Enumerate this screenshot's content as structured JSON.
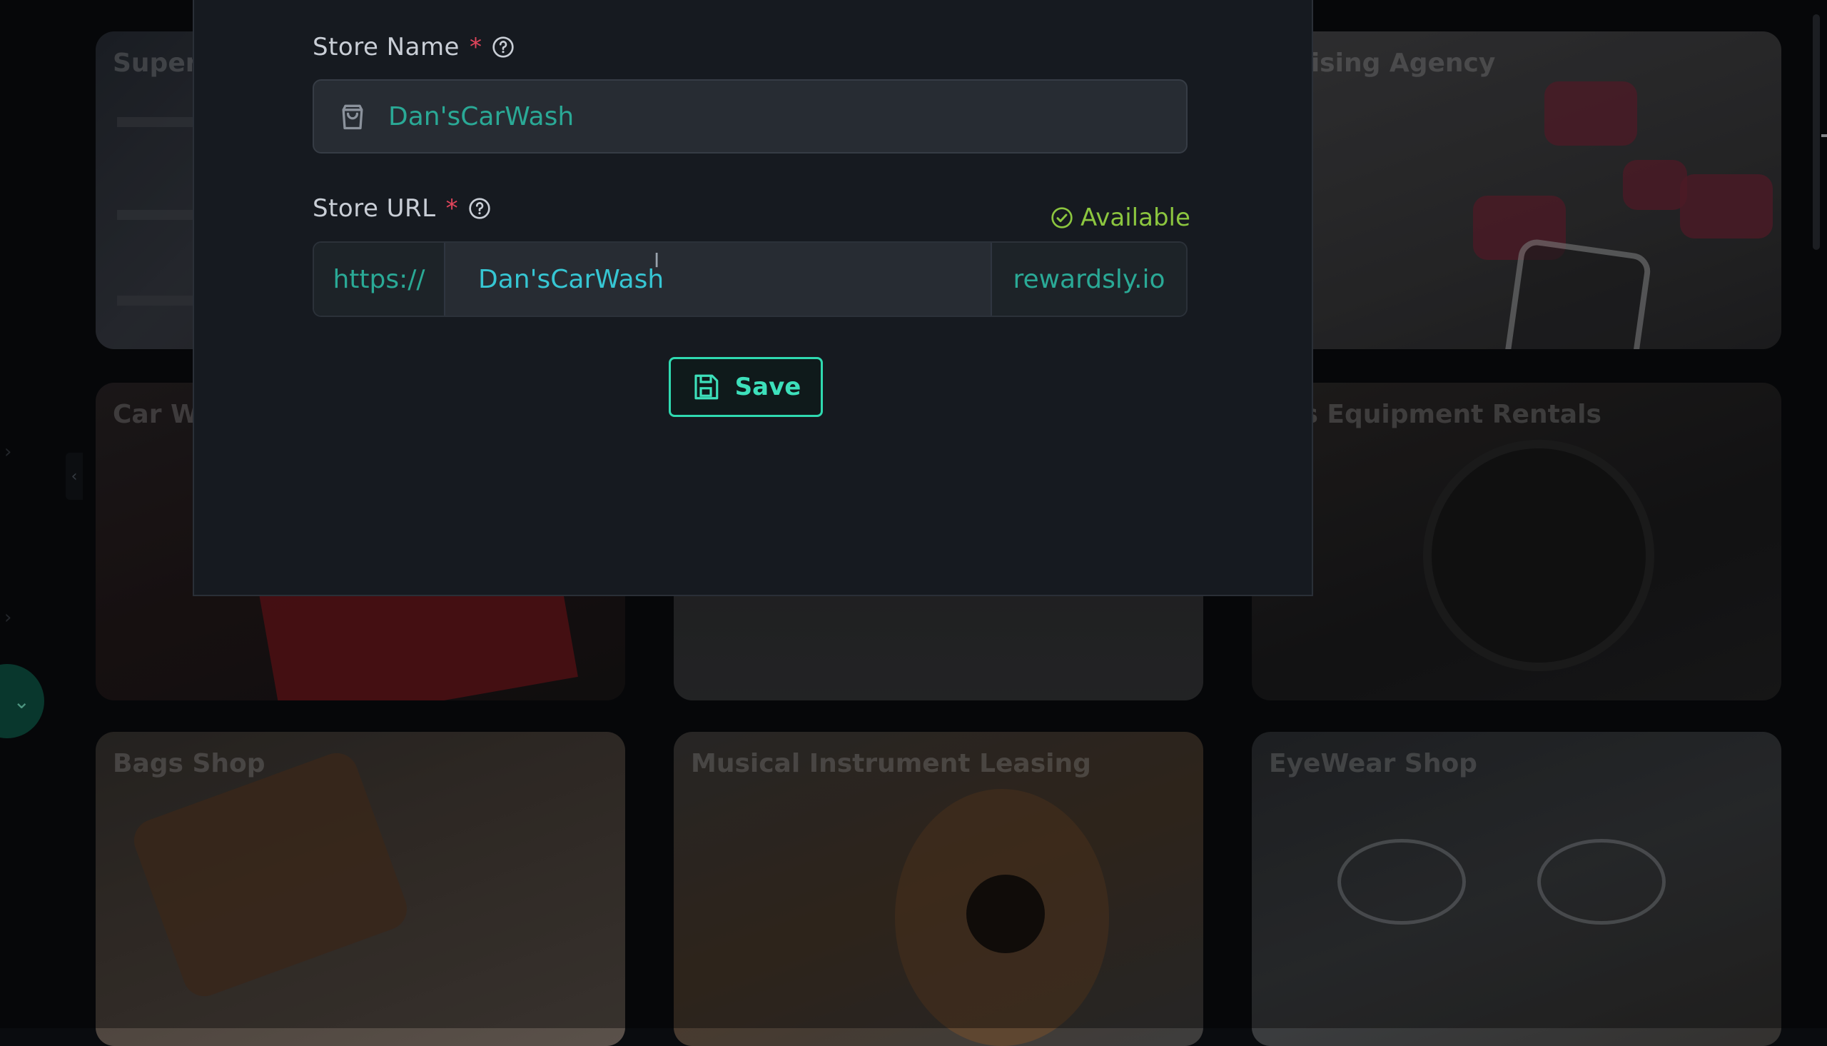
{
  "background_cards": [
    {
      "title": "Super"
    },
    {
      "title": "vertising Agency"
    },
    {
      "title": "Car W"
    },
    {
      "title": "ness Equipment Rentals"
    },
    {
      "title": "Bags Shop"
    },
    {
      "title": "Musical Instrument Leasing"
    },
    {
      "title": "EyeWear Shop"
    }
  ],
  "modal": {
    "store_name": {
      "label": "Store Name",
      "required_mark": "*",
      "value": "Dan'sCarWash",
      "icon": "shopping-bag-icon"
    },
    "store_url": {
      "label": "Store URL",
      "required_mark": "*",
      "prefix": "https://",
      "value": "Dan'sCarWash",
      "suffix": "rewardsly.io",
      "availability": "Available"
    },
    "save_button": {
      "label": "Save",
      "icon": "floppy-disk-icon"
    }
  },
  "colors": {
    "accent": "#2fd9b0",
    "available": "#8cc63f",
    "required": "#e0455b",
    "modal_bg": "#161a20"
  }
}
